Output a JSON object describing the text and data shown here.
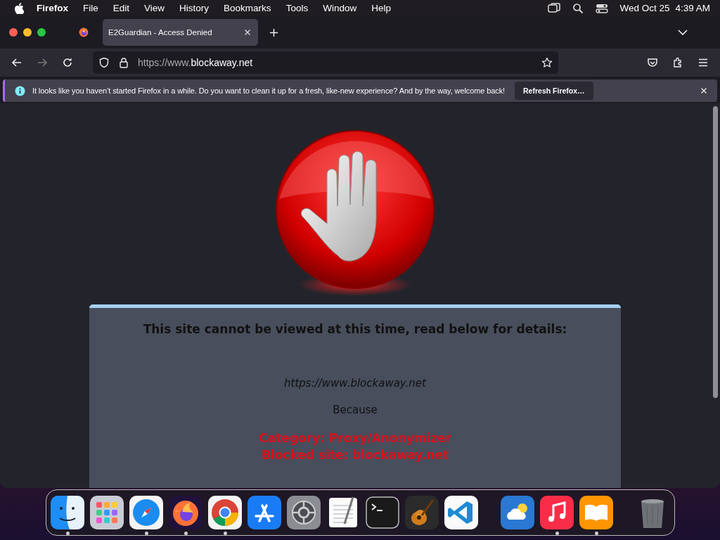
{
  "menu_bar": {
    "app": "Firefox",
    "items": [
      "File",
      "Edit",
      "View",
      "History",
      "Bookmarks",
      "Tools",
      "Window",
      "Help"
    ],
    "date": "Wed Oct 25",
    "time": "4:39 AM"
  },
  "tabs": [
    {
      "title": "E2Guardian - Access Denied",
      "selected": true
    }
  ],
  "navigation": {
    "back_disabled": false,
    "forward_disabled": true
  },
  "address_bar": {
    "prefix": "https://www.",
    "domain": "blockaway.net"
  },
  "notification": {
    "message": "It looks like you haven’t started Firefox in a while. Do you want to clean it up for a fresh, like-new experience? And by the way, welcome back!",
    "button": "Refresh Firefox…"
  },
  "page": {
    "heading": "This site cannot be viewed at this time, read below for details:",
    "url": "https://www.blockaway.net",
    "because": "Because",
    "reasons": [
      "Category: Proxy/Anonymizer",
      "Blocked site: blockaway.net"
    ]
  },
  "dock": {
    "items": [
      {
        "kind": "finder",
        "running": true
      },
      {
        "kind": "launchpad",
        "running": false
      },
      {
        "kind": "safari",
        "running": true
      },
      {
        "kind": "firefox",
        "running": true
      },
      {
        "kind": "chrome",
        "running": true
      },
      {
        "kind": "appstore",
        "running": false
      },
      {
        "kind": "settings",
        "running": false
      },
      {
        "kind": "textedit",
        "running": false
      },
      {
        "kind": "terminal",
        "running": false
      },
      {
        "kind": "garageband",
        "running": false
      },
      {
        "kind": "vscode",
        "running": false
      },
      {
        "kind": "separator"
      },
      {
        "kind": "weather",
        "running": false
      },
      {
        "kind": "music",
        "running": true
      },
      {
        "kind": "books",
        "running": true
      },
      {
        "kind": "separator"
      },
      {
        "kind": "trash",
        "running": false
      }
    ]
  }
}
